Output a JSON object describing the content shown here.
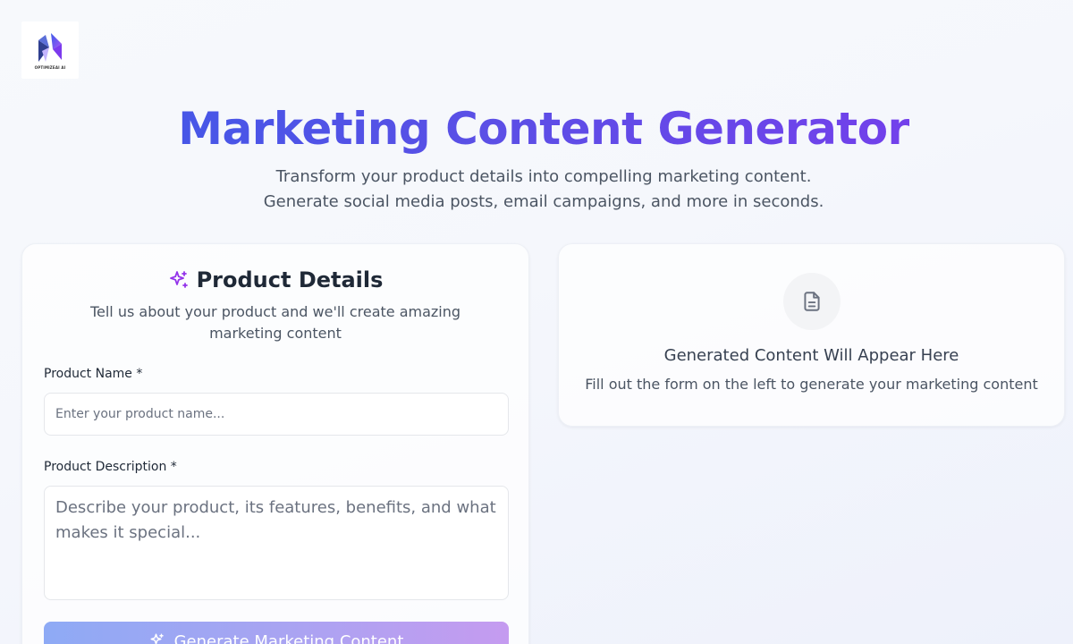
{
  "brand": {
    "logo_text": "OPTIMIZEAI AI"
  },
  "hero": {
    "title": "Marketing Content Generator",
    "subtitle": "Transform your product details into compelling marketing content. Generate social media posts, email campaigns, and more in seconds."
  },
  "form": {
    "title": "Product Details",
    "description": "Tell us about your product and we'll create amazing marketing content",
    "product_name": {
      "label": "Product Name *",
      "placeholder": "Enter your product name...",
      "value": ""
    },
    "product_description": {
      "label": "Product Description *",
      "placeholder": "Describe your product, its features, benefits, and what makes it special...",
      "value": ""
    },
    "submit_label": "Generate Marketing Content",
    "icon": "sparkles-icon"
  },
  "output": {
    "title": "Generated Content Will Appear Here",
    "description": "Fill out the form on the left to generate your marketing content",
    "icon": "document-icon"
  },
  "colors": {
    "title_gradient_start": "#3b5be8",
    "title_gradient_end": "#7c3aed",
    "accent_purple": "#7c3aed"
  }
}
